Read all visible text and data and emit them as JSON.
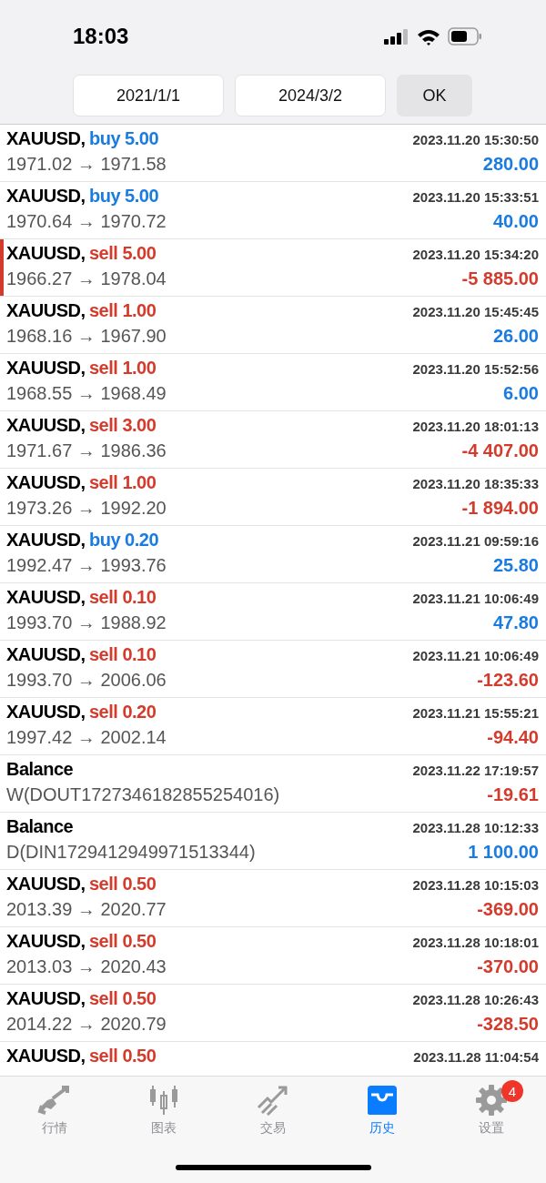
{
  "status_bar": {
    "time": "18:03"
  },
  "filter": {
    "from": "2021/1/1",
    "to": "2024/3/2",
    "button": "OK"
  },
  "rows": [
    {
      "kind": "buy",
      "symbol": "XAUUSD,",
      "order": "buy 5.00",
      "time": "2023.11.20 15:30:50",
      "prices": "1971.02 → 1971.58",
      "profit": "280.00",
      "loss": false,
      "highlighted": false
    },
    {
      "kind": "buy",
      "symbol": "XAUUSD,",
      "order": "buy 5.00",
      "time": "2023.11.20 15:33:51",
      "prices": "1970.64 → 1970.72",
      "profit": "40.00",
      "loss": false,
      "highlighted": false
    },
    {
      "kind": "sell",
      "symbol": "XAUUSD,",
      "order": "sell 5.00",
      "time": "2023.11.20 15:34:20",
      "prices": "1966.27 → 1978.04",
      "profit": "-5 885.00",
      "loss": true,
      "highlighted": true
    },
    {
      "kind": "sell",
      "symbol": "XAUUSD,",
      "order": "sell 1.00",
      "time": "2023.11.20 15:45:45",
      "prices": "1968.16 → 1967.90",
      "profit": "26.00",
      "loss": false,
      "highlighted": false
    },
    {
      "kind": "sell",
      "symbol": "XAUUSD,",
      "order": "sell 1.00",
      "time": "2023.11.20 15:52:56",
      "prices": "1968.55 → 1968.49",
      "profit": "6.00",
      "loss": false,
      "highlighted": false
    },
    {
      "kind": "sell",
      "symbol": "XAUUSD,",
      "order": "sell 3.00",
      "time": "2023.11.20 18:01:13",
      "prices": "1971.67 → 1986.36",
      "profit": "-4 407.00",
      "loss": true,
      "highlighted": false
    },
    {
      "kind": "sell",
      "symbol": "XAUUSD,",
      "order": "sell 1.00",
      "time": "2023.11.20 18:35:33",
      "prices": "1973.26 → 1992.20",
      "profit": "-1 894.00",
      "loss": true,
      "highlighted": false
    },
    {
      "kind": "buy",
      "symbol": "XAUUSD,",
      "order": "buy 0.20",
      "time": "2023.11.21 09:59:16",
      "prices": "1992.47 → 1993.76",
      "profit": "25.80",
      "loss": false,
      "highlighted": false
    },
    {
      "kind": "sell",
      "symbol": "XAUUSD,",
      "order": "sell 0.10",
      "time": "2023.11.21 10:06:49",
      "prices": "1993.70 → 1988.92",
      "profit": "47.80",
      "loss": false,
      "highlighted": false
    },
    {
      "kind": "sell",
      "symbol": "XAUUSD,",
      "order": "sell 0.10",
      "time": "2023.11.21 10:06:49",
      "prices": "1993.70 → 2006.06",
      "profit": "-123.60",
      "loss": true,
      "highlighted": false
    },
    {
      "kind": "sell",
      "symbol": "XAUUSD,",
      "order": "sell 0.20",
      "time": "2023.11.21 15:55:21",
      "prices": "1997.42 → 2002.14",
      "profit": "-94.40",
      "loss": true,
      "highlighted": false
    },
    {
      "kind": "balance",
      "symbol": "Balance",
      "time": "2023.11.22 17:19:57",
      "prices": "W(DOUT1727346182855254016)",
      "profit": "-19.61",
      "loss": true,
      "highlighted": false
    },
    {
      "kind": "balance",
      "symbol": "Balance",
      "time": "2023.11.28 10:12:33",
      "prices": "D(DIN1729412949971513344)",
      "profit": "1 100.00",
      "loss": false,
      "highlighted": false
    },
    {
      "kind": "sell",
      "symbol": "XAUUSD,",
      "order": "sell 0.50",
      "time": "2023.11.28 10:15:03",
      "prices": "2013.39 → 2020.77",
      "profit": "-369.00",
      "loss": true,
      "highlighted": false
    },
    {
      "kind": "sell",
      "symbol": "XAUUSD,",
      "order": "sell 0.50",
      "time": "2023.11.28 10:18:01",
      "prices": "2013.03 → 2020.43",
      "profit": "-370.00",
      "loss": true,
      "highlighted": false
    },
    {
      "kind": "sell",
      "symbol": "XAUUSD,",
      "order": "sell 0.50",
      "time": "2023.11.28 10:26:43",
      "prices": "2014.22 → 2020.79",
      "profit": "-328.50",
      "loss": true,
      "highlighted": false
    },
    {
      "kind": "sell",
      "symbol": "XAUUSD,",
      "order": "sell 0.50",
      "time": "2023.11.28 11:04:54",
      "highlighted": false
    }
  ],
  "tabs": [
    {
      "kind": "quotes",
      "label": "行情",
      "selected": false
    },
    {
      "kind": "chart",
      "label": "图表",
      "selected": false
    },
    {
      "kind": "trade",
      "label": "交易",
      "selected": false
    },
    {
      "kind": "history",
      "label": "历史",
      "selected": true
    },
    {
      "kind": "settings",
      "label": "设置",
      "selected": false,
      "badge": "4"
    }
  ]
}
